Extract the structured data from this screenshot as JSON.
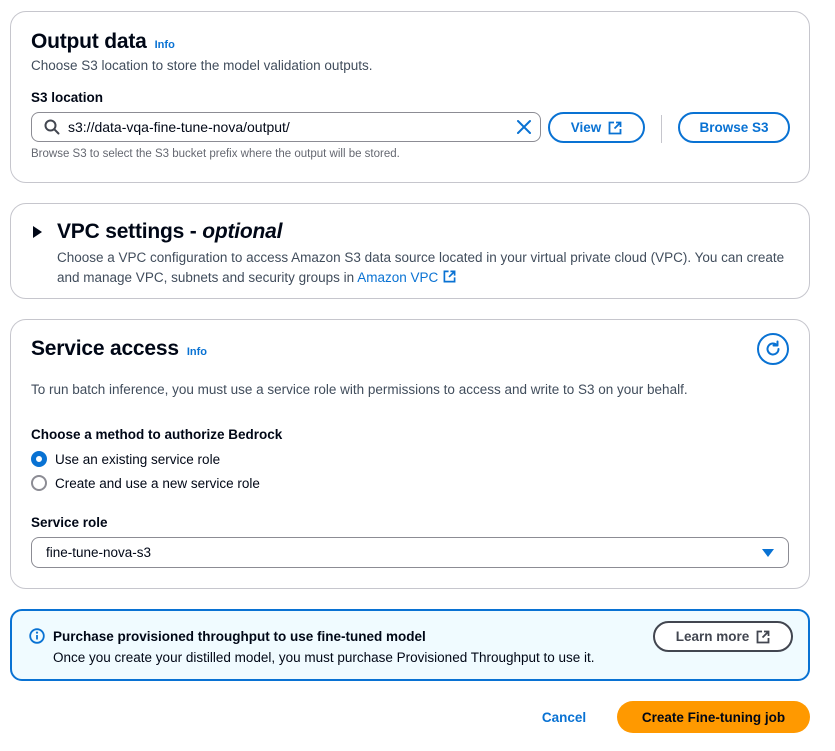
{
  "output_data": {
    "title": "Output data",
    "info_label": "Info",
    "description": "Choose S3 location to store the model validation outputs.",
    "s3_label": "S3 location",
    "s3_value": "s3://data-vqa-fine-tune-nova/output/",
    "view_label": "View",
    "browse_label": "Browse S3",
    "hint": "Browse S3 to select the S3 bucket prefix where the output will be stored."
  },
  "vpc": {
    "title": "VPC settings - ",
    "title_optional": "optional",
    "description": "Choose a VPC configuration to access Amazon S3 data source located in your virtual private cloud (VPC). You can create and manage VPC, subnets and security groups in ",
    "link": "Amazon VPC"
  },
  "service_access": {
    "title": "Service access",
    "info_label": "Info",
    "description": "To run batch inference, you must use a service role with permissions to access and write to S3 on your behalf.",
    "method_label": "Choose a method to authorize Bedrock",
    "options": [
      "Use an existing service role",
      "Create and use a new service role"
    ],
    "selected_option": "Use an existing service role",
    "role_label": "Service role",
    "role_value": "fine-tune-nova-s3"
  },
  "alert": {
    "title": "Purchase provisioned throughput to use fine-tuned model",
    "body": "Once you create your distilled model, you must purchase Provisioned Throughput to use it.",
    "button": "Learn more"
  },
  "footer": {
    "cancel": "Cancel",
    "create": "Create Fine-tuning job"
  },
  "colors": {
    "accent": "#0972d3",
    "primary_button": "#ff9900",
    "alert_background": "#f0fbff"
  }
}
